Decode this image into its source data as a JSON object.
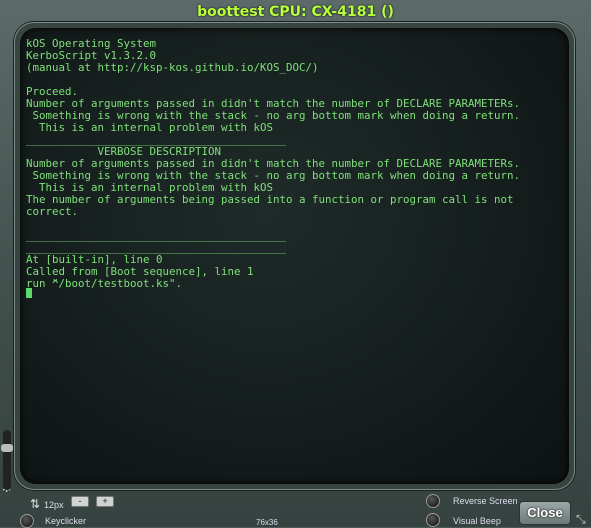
{
  "window": {
    "title": "boottest CPU: CX-4181 ()"
  },
  "terminal": {
    "lines": [
      "kOS Operating System",
      "KerboScript v1.3.2.0",
      "(manual at http://ksp-kos.github.io/KOS_DOC/)",
      "",
      "Proceed.",
      "Number of arguments passed in didn't match the number of DECLARE PARAMETERs.",
      " Something is wrong with the stack - no arg bottom mark when doing a return.",
      "  This is an internal problem with kOS",
      "________________________________________",
      "           VERBOSE DESCRIPTION",
      "Number of arguments passed in didn't match the number of DECLARE PARAMETERs.",
      " Something is wrong with the stack - no arg bottom mark when doing a return.",
      "  This is an internal problem with kOS",
      "The number of arguments being passed into a function or program call is not",
      "correct.",
      "",
      "________________________________________",
      "________________________________________",
      "At [built-in], line 0",
      "Called from [Boot sequence], line 1",
      "run \"/boot/testboot.ks\"."
    ],
    "caret": "^"
  },
  "controls": {
    "font_size": "12px",
    "minus": "-",
    "plus": "+",
    "keyclicker": "Keyclicker",
    "grid_size": "76x36",
    "reverse_screen": "Reverse Screen",
    "visual_beep": "Visual Beep",
    "close": "Close"
  }
}
